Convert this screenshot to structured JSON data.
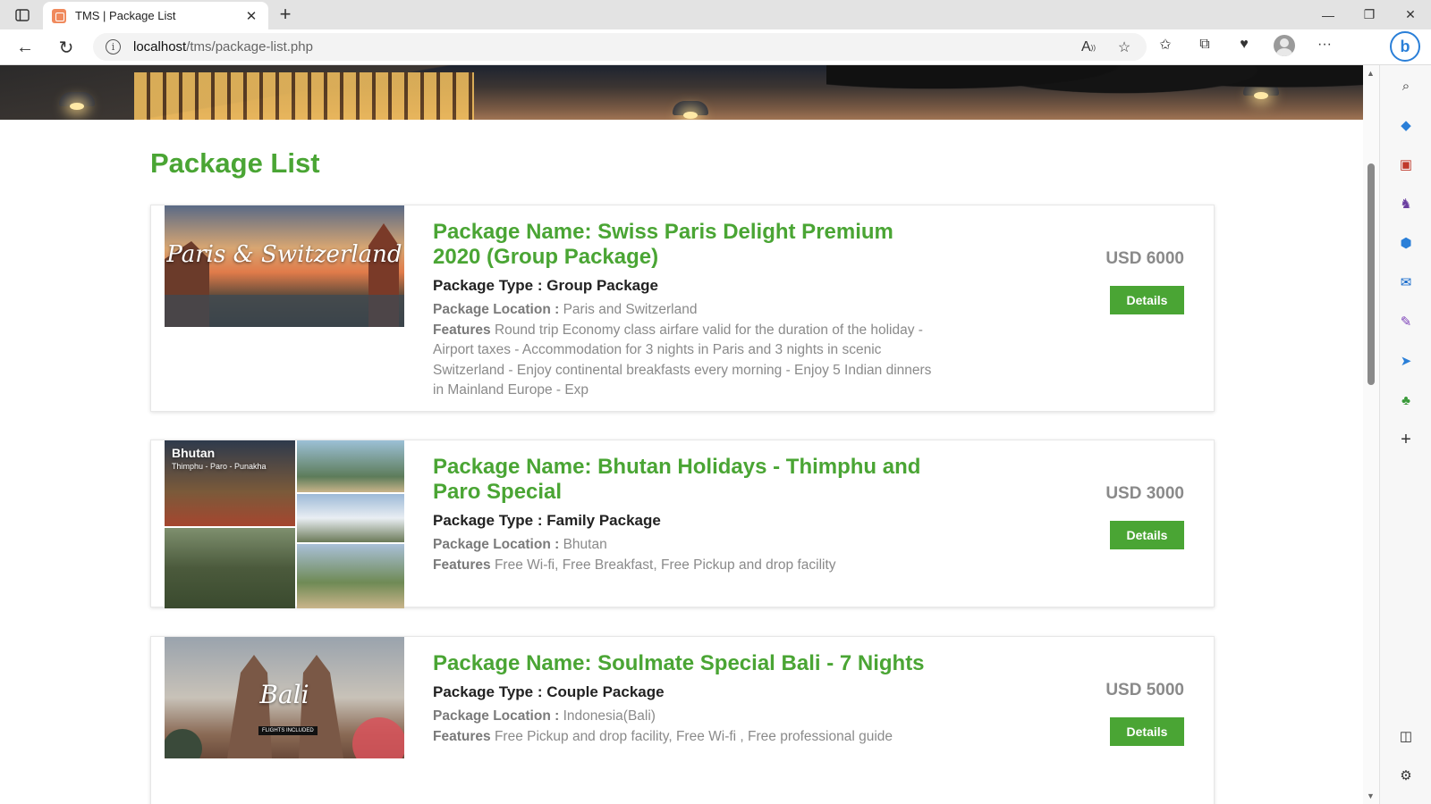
{
  "browser": {
    "tab_title": "TMS | Package List",
    "url_host": "localhost",
    "url_path": "/tms/package-list.php"
  },
  "page": {
    "heading": "Package List"
  },
  "packages": [
    {
      "name": "Package Name: Swiss Paris Delight Premium 2020 (Group Package)",
      "type": "Package Type : Group Package",
      "location_label": "Package Location :",
      "location": "Paris and Switzerland",
      "features_label": "Features",
      "features": "Round trip Economy class airfare valid for the duration of the holiday - Airport taxes - Accommodation for 3 nights in Paris and 3 nights in scenic Switzerland - Enjoy continental breakfasts every morning - Enjoy 5 Indian dinners in Mainland Europe - Exp",
      "price": "USD 6000",
      "button": "Details",
      "image_text": "Paris & Switzerland"
    },
    {
      "name": "Package Name: Bhutan Holidays - Thimphu and Paro Special",
      "type": "Package Type : Family Package",
      "location_label": "Package Location :",
      "location": "Bhutan",
      "features_label": "Features",
      "features": "Free Wi-fi, Free Breakfast, Free Pickup and drop facility",
      "price": "USD 3000",
      "button": "Details",
      "image_text": "Bhutan",
      "image_subtext": "Thimphu - Paro - Punakha"
    },
    {
      "name": "Package Name: Soulmate Special Bali - 7 Nights",
      "type": "Package Type : Couple Package",
      "location_label": "Package Location :",
      "location": "Indonesia(Bali)",
      "features_label": "Features",
      "features": "Free Pickup and drop facility, Free Wi-fi , Free professional guide",
      "price": "USD 5000",
      "button": "Details",
      "image_text": "Bali",
      "image_subtext": "FLIGHTS INCLUDED"
    }
  ],
  "colors": {
    "accent": "#4aa534",
    "muted_text": "#8a8a8a"
  }
}
